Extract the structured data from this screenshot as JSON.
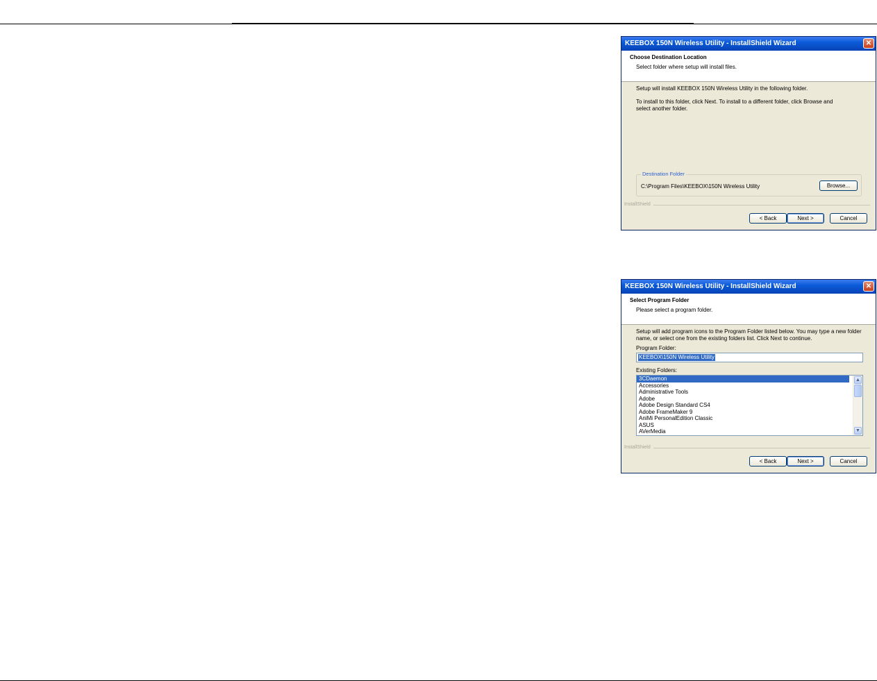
{
  "dialog1": {
    "title": "KEEBOX 150N Wireless Utility - InstallShield Wizard",
    "close_glyph": "✕",
    "header_title": "Choose Destination Location",
    "header_subtitle": "Select folder where setup will install files.",
    "line1": "Setup will install KEEBOX 150N Wireless Utility in the following folder.",
    "line2": "To install to this folder, click Next. To install to a different folder, click Browse and select another folder.",
    "group_label": "Destination Folder",
    "destination_path": "C:\\Program Files\\KEEBOX\\150N Wireless Utility",
    "browse_label": "Browse...",
    "brand": "InstallShield",
    "back_label": "< Back",
    "next_label": "Next >",
    "cancel_label": "Cancel"
  },
  "dialog2": {
    "title": "KEEBOX 150N Wireless Utility - InstallShield Wizard",
    "close_glyph": "✕",
    "header_title": "Select Program Folder",
    "header_subtitle": "Please select a program folder.",
    "line1": "Setup will add program icons to the Program Folder listed below.  You may type a new folder name, or select one from the existing folders list.  Click Next to continue.",
    "program_folder_label": "Program Folder:",
    "program_folder_value": "KEEBOX\\150N Wireless Utility",
    "existing_folders_label": "Existing Folders:",
    "existing_folders": [
      "3CDaemon",
      "Accessories",
      "Administrative Tools",
      "Adobe",
      "Adobe Design Standard CS4",
      "Adobe FrameMaker 9",
      "AniMi PersonalEdition Classic",
      "ASUS",
      "AVerMedia"
    ],
    "selected_folder_index": 0,
    "brand": "InstallShield",
    "back_label": "< Back",
    "next_label": "Next >",
    "cancel_label": "Cancel",
    "scroll_up": "▲",
    "scroll_down": "▼"
  }
}
